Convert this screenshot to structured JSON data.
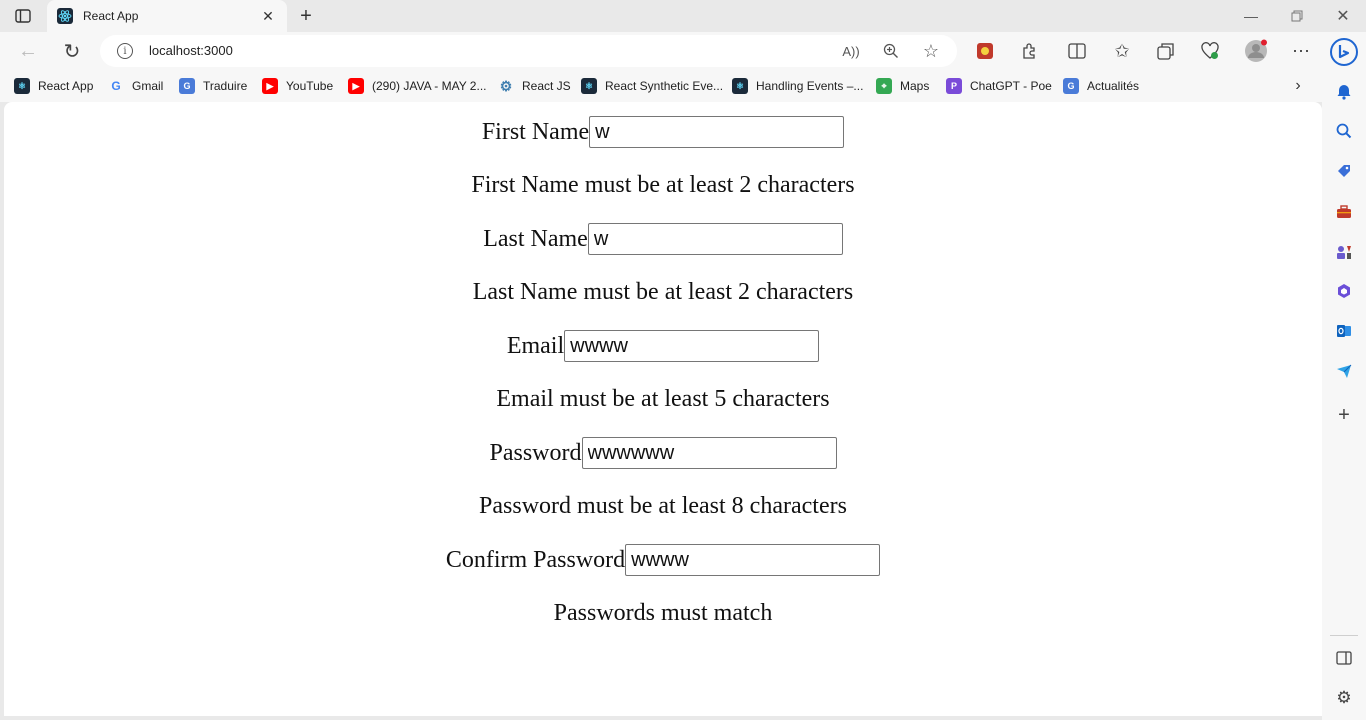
{
  "browser": {
    "tab": {
      "title": "React App"
    },
    "address": {
      "url": "localhost:3000"
    },
    "bookmarks": [
      {
        "label": "React App",
        "icon": "react-icon",
        "color": "#1b2a3a"
      },
      {
        "label": "Gmail",
        "icon": "google-icon",
        "color": "#ffffff"
      },
      {
        "label": "Traduire",
        "icon": "translate-icon",
        "color": "#4a7bd8"
      },
      {
        "label": "YouTube",
        "icon": "youtube-icon",
        "color": "#ff0000"
      },
      {
        "label": "(290) JAVA - MAY 2...",
        "icon": "youtube-icon",
        "color": "#ff0000"
      },
      {
        "label": "React JS",
        "icon": "gear-icon",
        "color": "#3f7fb0"
      },
      {
        "label": "React Synthetic Eve...",
        "icon": "react-icon",
        "color": "#1b2a3a"
      },
      {
        "label": "Handling Events –...",
        "icon": "react-icon",
        "color": "#1b2a3a"
      },
      {
        "label": "Maps",
        "icon": "maps-icon",
        "color": "#34a853"
      },
      {
        "label": "ChatGPT - Poe",
        "icon": "poe-icon",
        "color": "#7a4bd8"
      },
      {
        "label": "Actualités",
        "icon": "news-icon",
        "color": "#4a7bd8"
      }
    ]
  },
  "form": {
    "first_name": {
      "label": "First Name",
      "value": "w",
      "error": "First Name must be at least 2 characters"
    },
    "last_name": {
      "label": "Last Name",
      "value": "w",
      "error": "Last Name must be at least 2 characters"
    },
    "email": {
      "label": "Email",
      "value": "wwww",
      "error": "Email must be at least 5 characters"
    },
    "password": {
      "label": "Password",
      "value": "wwwwww",
      "error": "Password must be at least 8 characters"
    },
    "confirm_password": {
      "label": "Confirm Password",
      "value": "wwww",
      "error": "Passwords must match"
    }
  }
}
